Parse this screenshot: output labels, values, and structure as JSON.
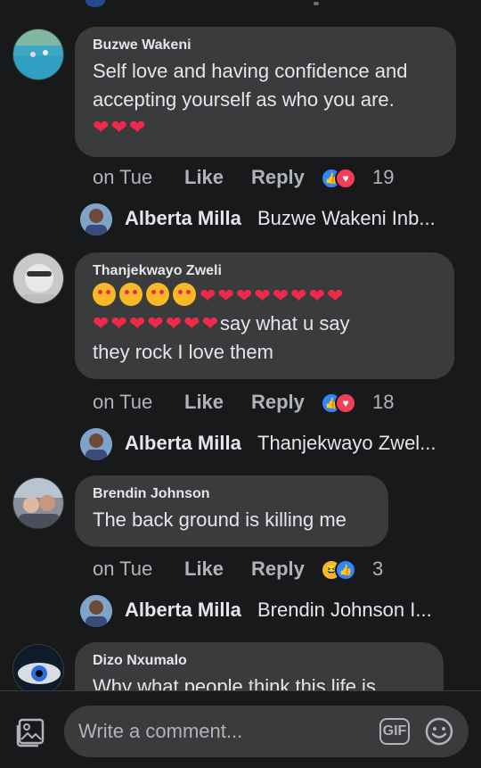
{
  "comments": [
    {
      "author": "Buzwe Wakeni",
      "text_line1": "Self love and having confidence and",
      "text_line2": "accepting yourself as who you are.",
      "time": "on Tue",
      "like_label": "Like",
      "reply_label": "Reply",
      "reaction_count": "19",
      "reactions": [
        "like-icon",
        "love-icon"
      ]
    },
    {
      "author": "Thanjekwayo Zweli",
      "text_tail": "say what u say",
      "text_line3": "they rock I love them",
      "time": "on Tue",
      "like_label": "Like",
      "reply_label": "Reply",
      "reaction_count": "18",
      "reactions": [
        "like-icon",
        "love-icon"
      ]
    },
    {
      "author": "Brendin Johnson",
      "text": "The back ground is killing me",
      "time": "on Tue",
      "like_label": "Like",
      "reply_label": "Reply",
      "reaction_count": "3",
      "reactions": [
        "haha-icon",
        "like-icon"
      ]
    },
    {
      "author": "Dizo Nxumalo",
      "text": "Why what  people think this life is"
    }
  ],
  "replies": [
    {
      "author": "Alberta Milla",
      "preview": "Buzwe Wakeni Inb..."
    },
    {
      "author": "Alberta Milla",
      "preview": "Thanjekwayo Zwel..."
    },
    {
      "author": "Alberta Milla",
      "preview": "Brendin Johnson I..."
    }
  ],
  "composer": {
    "placeholder": "Write a comment...",
    "gif_label": "GIF"
  },
  "colors": {
    "background": "#18191a",
    "bubble": "#3a3b3c",
    "like_blue": "#2d88ff",
    "love_red": "#f33e58",
    "heart_red": "#f02849"
  }
}
